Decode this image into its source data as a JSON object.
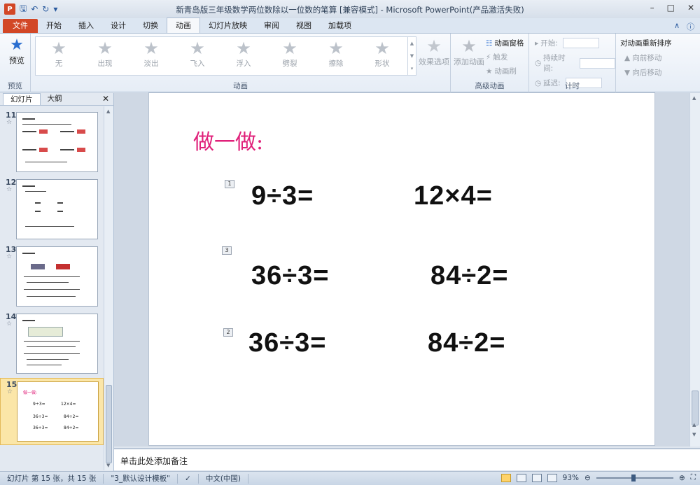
{
  "window": {
    "title": "新青岛版三年级数学两位数除以一位数的笔算 [兼容模式] - Microsoft PowerPoint(产品激活失败)",
    "app_letter": "P"
  },
  "tabs": [
    "文件",
    "开始",
    "插入",
    "设计",
    "切换",
    "动画",
    "幻灯片放映",
    "审阅",
    "视图",
    "加载项"
  ],
  "ribbon": {
    "preview_label": "预览",
    "preview_group": "预览",
    "effects": [
      "无",
      "出现",
      "淡出",
      "飞入",
      "浮入",
      "劈裂",
      "擦除",
      "形状"
    ],
    "effect_options": "效果选项",
    "anim_group": "动画",
    "add_anim": "添加动画",
    "anim_pane": "动画窗格",
    "trigger": "触发",
    "anim_brush": "动画刷",
    "adv_group": "高级动画",
    "start": "开始:",
    "duration": "持续时间:",
    "delay": "延迟:",
    "timing_group": "计时",
    "reorder": "对动画重新排序",
    "move_earlier": "向前移动",
    "move_later": "向后移动"
  },
  "panel": {
    "tab_slides": "幻灯片",
    "tab_outline": "大纲",
    "thumbs": [
      {
        "num": "11"
      },
      {
        "num": "12"
      },
      {
        "num": "13"
      },
      {
        "num": "14"
      },
      {
        "num": "15",
        "title": "做一做:",
        "eqs": [
          "9÷3=",
          "12×4=",
          "36÷3=",
          "84÷2=",
          "36÷3=",
          "84÷2="
        ]
      }
    ]
  },
  "slide": {
    "title": "做一做:",
    "tags": [
      "1",
      "3",
      "2"
    ],
    "equations": [
      "9÷3=",
      "12×4=",
      "36÷3=",
      "84÷2=",
      "36÷3=",
      "84÷2="
    ]
  },
  "notes_placeholder": "单击此处添加备注",
  "status": {
    "slide_info": "幻灯片 第 15 张，共 15 张",
    "theme": "\"3_默认设计模板\"",
    "language": "中文(中国)",
    "zoom": "93%"
  }
}
